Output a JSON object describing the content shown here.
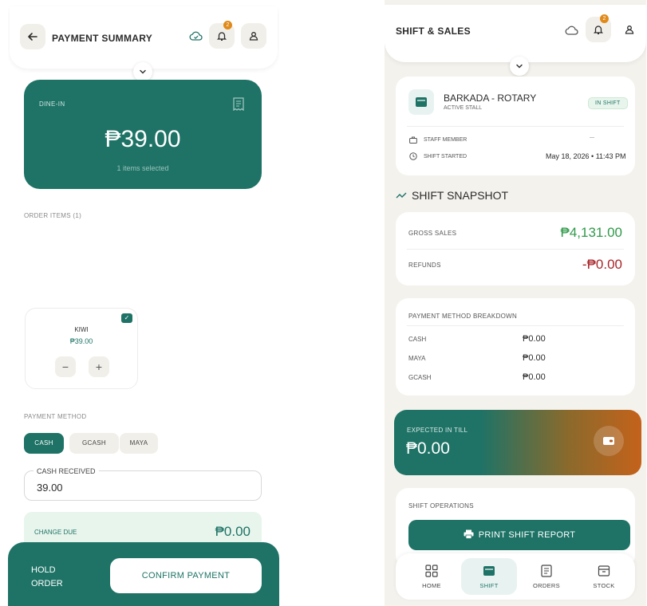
{
  "left": {
    "title": "PAYMENT SUMMARY",
    "notification_count": "2",
    "hero": {
      "label": "DINE-IN",
      "amount": "₱39.00",
      "subtitle": "1 items selected"
    },
    "order_items_label": "ORDER ITEMS (1)",
    "item": {
      "name": "KIWI",
      "price": "₱39.00",
      "minus": "−",
      "plus": "+"
    },
    "payment_method_label": "PAYMENT METHOD",
    "payment_methods": [
      "CASH",
      "GCASH",
      "MAYA"
    ],
    "selected_method": "CASH",
    "cash_received": {
      "label": "CASH RECEIVED",
      "value": "39.00"
    },
    "change_due": {
      "label": "CHANGE DUE",
      "value": "₱0.00"
    },
    "hold_order_line1": "HOLD",
    "hold_order_line2": "ORDER",
    "confirm_label": "CONFIRM PAYMENT"
  },
  "right": {
    "title": "SHIFT & SALES",
    "notification_count": "2",
    "stall": {
      "name": "BARKADA - ROTARY",
      "status": "ACTIVE STALL",
      "badge": "IN SHIFT",
      "staff_label": "STAFF MEMBER",
      "staff_value": "—",
      "shift_started_label": "SHIFT STARTED",
      "shift_started_value": "May 18, 2026 • 11:43 PM"
    },
    "snapshot_title": "SHIFT SNAPSHOT",
    "gross_sales": {
      "label": "GROSS SALES",
      "value": "₱4,131.00"
    },
    "refunds": {
      "label": "REFUNDS",
      "value": "-₱0.00"
    },
    "breakdown": {
      "title": "PAYMENT METHOD BREAKDOWN",
      "rows": [
        {
          "label": "CASH",
          "value": "₱0.00"
        },
        {
          "label": "MAYA",
          "value": "₱0.00"
        },
        {
          "label": "GCASH",
          "value": "₱0.00"
        }
      ]
    },
    "expected": {
      "label": "EXPECTED IN TILL",
      "value": "₱0.00"
    },
    "operations_label": "SHIFT OPERATIONS",
    "print_label": "PRINT SHIFT REPORT",
    "nav": [
      {
        "label": "HOME",
        "icon": "home-grid-icon"
      },
      {
        "label": "SHIFT",
        "icon": "shift-store-icon"
      },
      {
        "label": "ORDERS",
        "icon": "orders-icon"
      },
      {
        "label": "STOCK",
        "icon": "stock-box-icon"
      }
    ]
  },
  "colors": {
    "teal": "#1e7366",
    "accent_orange": "#e08a1a",
    "refund_red": "#a8262a",
    "gross_green": "#2f9a4a"
  }
}
